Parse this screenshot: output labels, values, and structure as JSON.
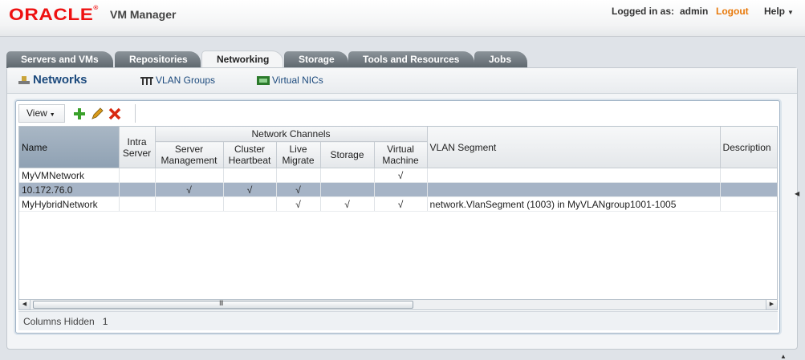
{
  "header": {
    "logo_text": "ORACLE",
    "app_title": "VM Manager",
    "login_label": "Logged in as:",
    "user_name": "admin",
    "logout_label": "Logout",
    "help_label": "Help"
  },
  "tabs": [
    {
      "label": "Servers and VMs"
    },
    {
      "label": "Repositories"
    },
    {
      "label": "Networking",
      "active": true
    },
    {
      "label": "Storage"
    },
    {
      "label": "Tools and Resources"
    },
    {
      "label": "Jobs"
    }
  ],
  "subtabs": {
    "networks_label": "Networks",
    "vlan_groups_label": "VLAN Groups",
    "virtual_nics_label": "Virtual NICs"
  },
  "toolbar": {
    "view_label": "View",
    "icons": [
      "add-icon",
      "edit-icon",
      "delete-icon"
    ],
    "colors": {
      "add": "#3aa12a",
      "edit": "#d99a1a",
      "delete": "#d8280f"
    }
  },
  "table": {
    "headers": {
      "name": "Name",
      "intra_server": "Intra Server",
      "network_channels": "Network Channels",
      "server_management": "Server Management",
      "cluster_heartbeat": "Cluster Heartbeat",
      "live_migrate": "Live Migrate",
      "storage": "Storage",
      "virtual_machine": "Virtual Machine",
      "vlan_segment": "VLAN Segment",
      "description": "Description"
    },
    "rows": [
      {
        "name": "MyVMNetwork",
        "intra": "",
        "mgmt": "",
        "heartbeat": "",
        "live": "",
        "storage": "",
        "vm": "√",
        "vlan": "",
        "desc": "",
        "selected": false
      },
      {
        "name": "10.172.76.0",
        "intra": "",
        "mgmt": "√",
        "heartbeat": "√",
        "live": "√",
        "storage": "",
        "vm": "",
        "vlan": "",
        "desc": "",
        "selected": true
      },
      {
        "name": "MyHybridNetwork",
        "intra": "",
        "mgmt": "",
        "heartbeat": "",
        "live": "√",
        "storage": "√",
        "vm": "√",
        "vlan": "network.VlanSegment (1003) in MyVLANgroup1001-1005",
        "desc": "",
        "selected": false
      }
    ]
  },
  "scrollbar": {
    "grip": "III"
  },
  "status": {
    "label": "Columns Hidden",
    "count": "1"
  }
}
